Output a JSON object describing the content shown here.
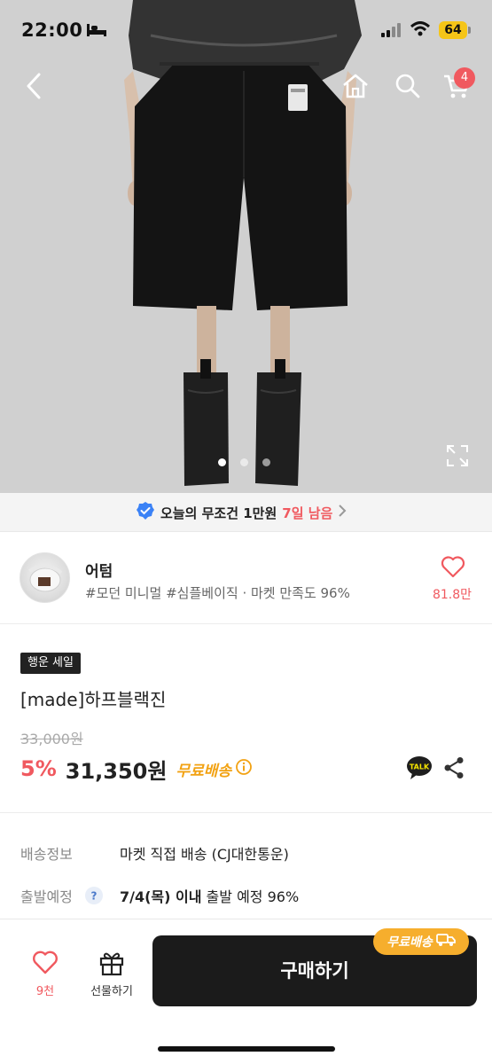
{
  "status_bar": {
    "time": "22:00",
    "battery": "64",
    "icons": [
      "bed-icon",
      "signal-icon",
      "wifi-icon",
      "battery-icon"
    ]
  },
  "nav": {
    "icons": [
      "back-icon",
      "home-icon",
      "search-icon",
      "cart-icon"
    ],
    "cart_count": "4"
  },
  "gallery": {
    "image": "product-photo",
    "slide_count": 3,
    "active_slide": 1,
    "expand_icon": "expand-icon"
  },
  "promo": {
    "text": "오늘의 무조건 1만원",
    "highlight": "7일 남음",
    "icon": "verified-badge-icon"
  },
  "shop": {
    "name": "어텀",
    "tags": "#모던 미니멀 #심플베이직 · 마켓 만족도 96%",
    "likes": "81.8만"
  },
  "product": {
    "badge": "행운 세일",
    "title": "[made]하프블랙진",
    "original_price": "33,000원",
    "discount": "5%",
    "price": "31,350원",
    "free_shipping": "무료배송"
  },
  "shipping": {
    "rows": [
      {
        "label": "배송정보",
        "value": "마켓 직접 배송 (CJ대한통운)"
      },
      {
        "label": "출발예정",
        "value_bold": "7/4(목) 이내",
        "value_rest": " 출발 예정 96%"
      }
    ]
  },
  "bottom_bar": {
    "wish_count": "9천",
    "gift_label": "선물하기",
    "buy_label": "구매하기",
    "ship_pill": "무료배송"
  },
  "colors": {
    "accent_red": "#f0595f",
    "free_ship_orange": "#f2a213",
    "buy_button": "#1b1b1b",
    "battery": "#f5c518"
  }
}
